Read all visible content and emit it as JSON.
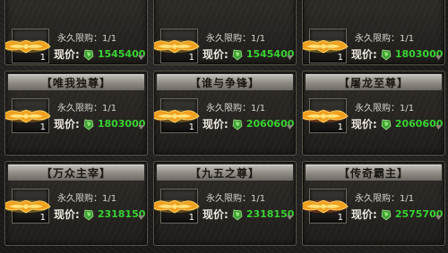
{
  "limit_label": "永久限购：1/1",
  "price_label": "现价:",
  "slot_count": "1",
  "items": [
    {
      "title": "",
      "price": "1545400",
      "glow": "#ffb21a"
    },
    {
      "title": "",
      "price": "1545400",
      "glow": "#ffb21a"
    },
    {
      "title": "",
      "price": "1803000",
      "glow": "#ffc21a"
    },
    {
      "title": "【唯我独尊】",
      "price": "1803000",
      "glow": "#ff9a10"
    },
    {
      "title": "【谁与争锋】",
      "price": "2060600",
      "glow": "#ffb020"
    },
    {
      "title": "【屠龙至尊】",
      "price": "2060600",
      "glow": "#ff6a10"
    },
    {
      "title": "【万众主宰】",
      "price": "2318150",
      "glow": "#ffc020"
    },
    {
      "title": "【九五之尊】",
      "price": "2318150",
      "glow": "#ffa818"
    },
    {
      "title": "【传奇霸主】",
      "price": "2575700",
      "glow": "#ff5a10"
    }
  ],
  "colors": {
    "price_green": "#39d232",
    "limit_text": "#d8d4cc",
    "title_bar": "#b9b5ae"
  },
  "icons": {
    "currency": "green-gem-icon",
    "scroll": "scroll-down-arrow-icon"
  }
}
